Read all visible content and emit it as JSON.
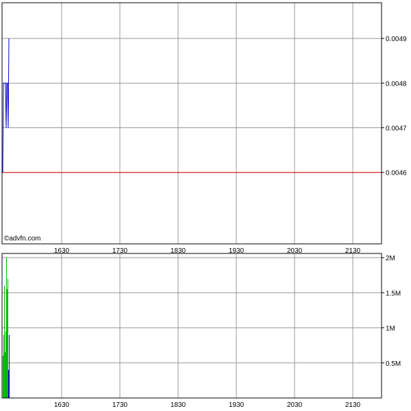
{
  "watermark": "©advfn.com",
  "colors": {
    "price_line": "#0000cc",
    "reference_line": "#dd0000",
    "volume_bar": "#00bb00",
    "volume_bar_late": "#0000cc",
    "grid": "#999999",
    "frame": "#000000"
  },
  "x_ticks": [
    "1630",
    "1730",
    "1830",
    "1930",
    "2030",
    "2130"
  ],
  "chart_data": [
    {
      "type": "line",
      "name": "price",
      "x_ticks": [
        "1630",
        "1730",
        "1830",
        "1930",
        "2030",
        "2130"
      ],
      "y_ticks": [
        "0.0049",
        "0.0048",
        "0.0047",
        "0.0046"
      ],
      "ylim": [
        0.00444,
        0.00498
      ],
      "xlim": [
        "1530",
        "2200"
      ],
      "grid": true,
      "series": [
        {
          "color": "#0000cc",
          "x": [
            "1530",
            "1531",
            "1532",
            "1533",
            "1534",
            "1535",
            "1536",
            "1537",
            "1538",
            "1539"
          ],
          "y": [
            0.0046,
            0.0048,
            0.0048,
            0.0048,
            0.0048,
            0.0047,
            0.0048,
            0.0048,
            0.0047,
            0.0049
          ]
        }
      ],
      "reference_line": {
        "y": 0.0046,
        "color": "#dd0000"
      }
    },
    {
      "type": "bar",
      "name": "volume",
      "x_ticks": [
        "1630",
        "1730",
        "1830",
        "1930",
        "2030",
        "2130"
      ],
      "y_ticks": [
        "2M",
        "1.5M",
        "1M",
        "0.5M"
      ],
      "ylim": [
        0,
        2060000
      ],
      "grid": true,
      "bars": [
        {
          "x": "1530",
          "value": 600000,
          "color": "#00bb00"
        },
        {
          "x": "1531",
          "value": 900000,
          "color": "#00bb00"
        },
        {
          "x": "1532",
          "value": 1600000,
          "color": "#00bb00"
        },
        {
          "x": "1533",
          "value": 650000,
          "color": "#00bb00"
        },
        {
          "x": "1534",
          "value": 950000,
          "color": "#00bb00"
        },
        {
          "x": "1535",
          "value": 2000000,
          "color": "#00bb00"
        },
        {
          "x": "1536",
          "value": 1550000,
          "color": "#00bb00"
        },
        {
          "x": "1537",
          "value": 1700000,
          "color": "#00bb00"
        },
        {
          "x": "1538",
          "value": 400000,
          "color": "#0000cc"
        },
        {
          "x": "1539",
          "value": 900000,
          "color": "#0000cc"
        }
      ]
    }
  ]
}
